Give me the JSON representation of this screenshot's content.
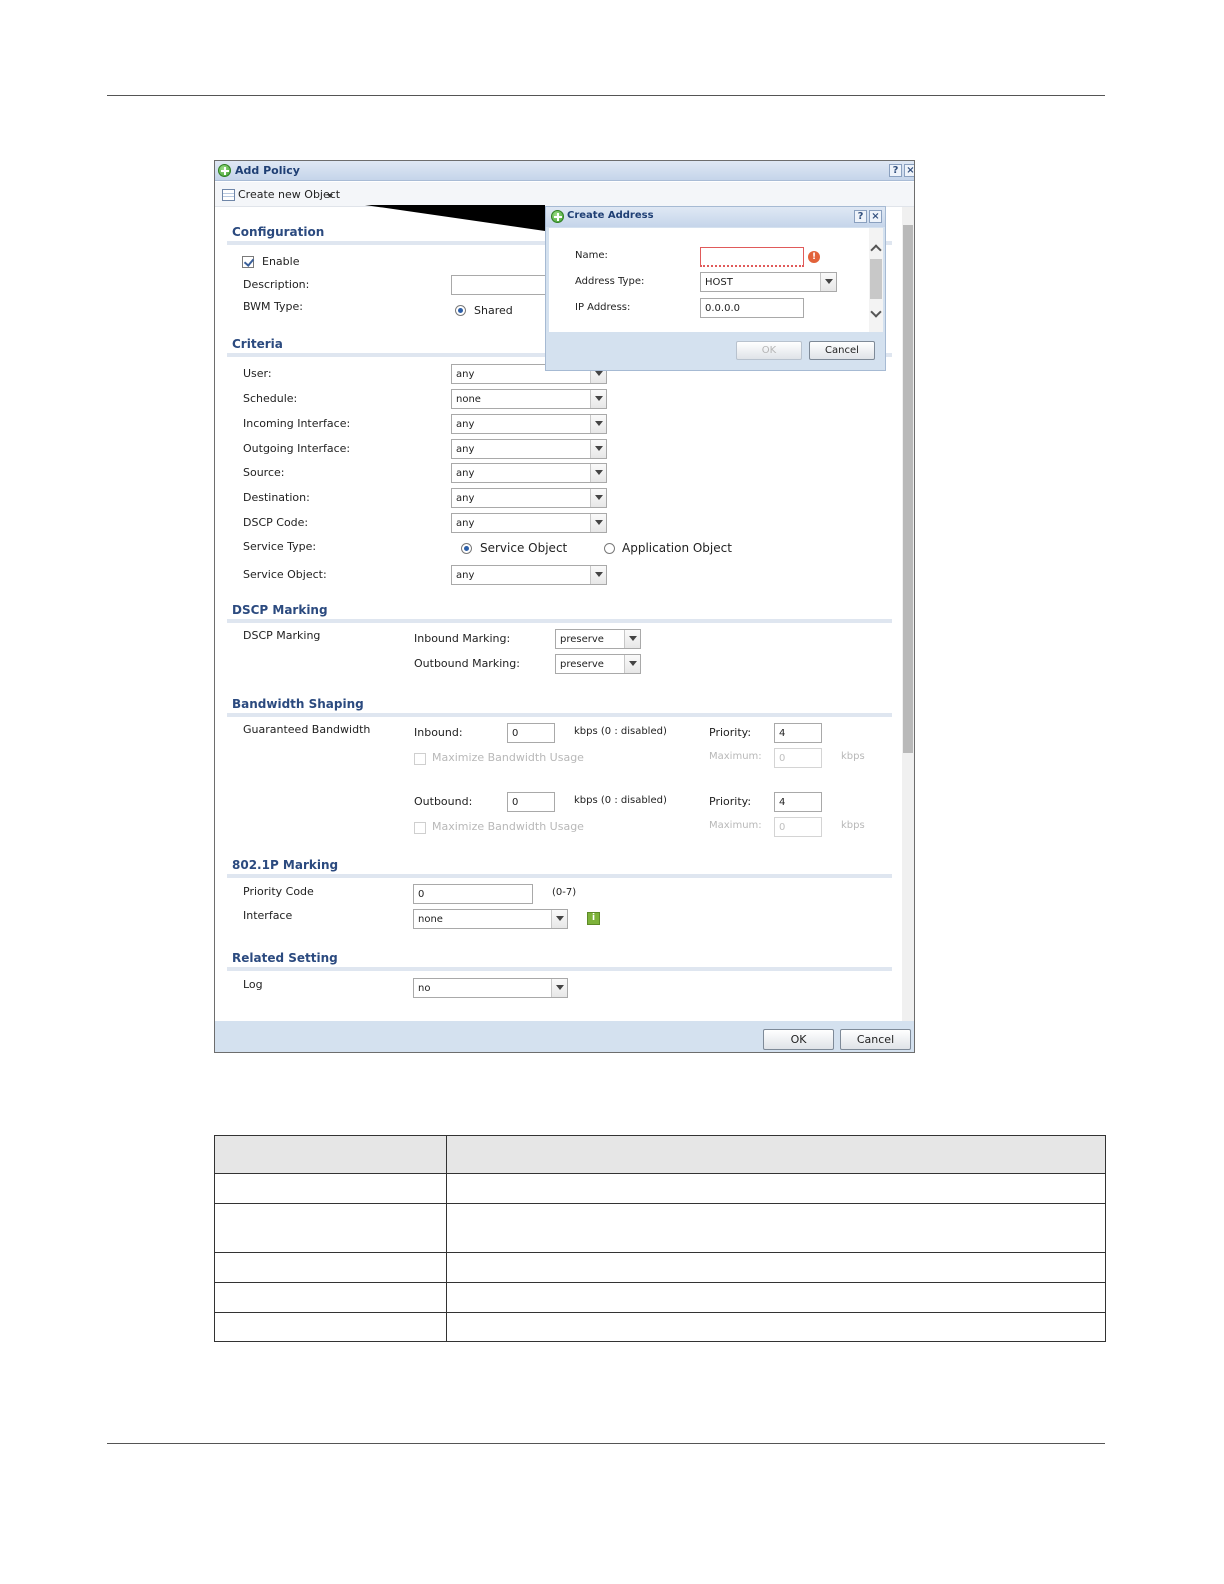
{
  "window": {
    "title": "Add Policy",
    "help_label": "?",
    "close_label": "×"
  },
  "toolbar": {
    "create_new_object": "Create new Object"
  },
  "configuration": {
    "heading": "Configuration",
    "enable_label": "Enable",
    "enable_checked": true,
    "description_label": "Description:",
    "description_value": "",
    "bwm_type_label": "BWM Type:",
    "bwm_type_option": "Shared"
  },
  "criteria": {
    "heading": "Criteria",
    "fields": [
      {
        "label": "User:",
        "value": "any"
      },
      {
        "label": "Schedule:",
        "value": "none"
      },
      {
        "label": "Incoming Interface:",
        "value": "any"
      },
      {
        "label": "Outgoing Interface:",
        "value": "any"
      },
      {
        "label": "Source:",
        "value": "any"
      },
      {
        "label": "Destination:",
        "value": "any"
      },
      {
        "label": "DSCP Code:",
        "value": "any"
      }
    ],
    "service_type_label": "Service Type:",
    "service_type_options": [
      "Service Object",
      "Application Object"
    ],
    "service_type_selected": "Service Object",
    "service_object_label": "Service Object:",
    "service_object_value": "any"
  },
  "dscp_marking": {
    "heading": "DSCP Marking",
    "row_label": "DSCP Marking",
    "inbound_label": "Inbound Marking:",
    "inbound_value": "preserve",
    "outbound_label": "Outbound Marking:",
    "outbound_value": "preserve"
  },
  "bandwidth_shaping": {
    "heading": "Bandwidth Shaping",
    "row_label": "Guaranteed Bandwidth",
    "inbound_label": "Inbound:",
    "inbound_value": "0",
    "inbound_hint": "kbps (0 : disabled)",
    "inbound_priority_label": "Priority:",
    "inbound_priority_value": "4",
    "inbound_max_usage_label": "Maximize Bandwidth Usage",
    "inbound_maximum_label": "Maximum:",
    "inbound_maximum_value": "0",
    "inbound_maximum_unit": "kbps",
    "outbound_label": "Outbound:",
    "outbound_value": "0",
    "outbound_hint": "kbps (0 : disabled)",
    "outbound_priority_label": "Priority:",
    "outbound_priority_value": "4",
    "outbound_max_usage_label": "Maximize Bandwidth Usage",
    "outbound_maximum_label": "Maximum:",
    "outbound_maximum_value": "0",
    "outbound_maximum_unit": "kbps"
  },
  "marking_8021p": {
    "heading": "802.1P Marking",
    "priority_code_label": "Priority Code",
    "priority_code_value": "0",
    "priority_code_hint": "(0-7)",
    "interface_label": "Interface",
    "interface_value": "none"
  },
  "related_setting": {
    "heading": "Related Setting",
    "log_label": "Log",
    "log_value": "no"
  },
  "footer": {
    "ok_label": "OK",
    "cancel_label": "Cancel"
  },
  "create_address": {
    "title": "Create Address",
    "help_label": "?",
    "close_label": "×",
    "name_label": "Name:",
    "name_value": "",
    "address_type_label": "Address Type:",
    "address_type_value": "HOST",
    "ip_address_label": "IP Address:",
    "ip_address_value": "0.0.0.0",
    "ok_label": "OK",
    "cancel_label": "Cancel"
  },
  "colors": {
    "section_heading": "#2b4a7f",
    "titlebar": "#c5d5ea",
    "footer": "#d4e1ef",
    "error": "#e2623a"
  }
}
